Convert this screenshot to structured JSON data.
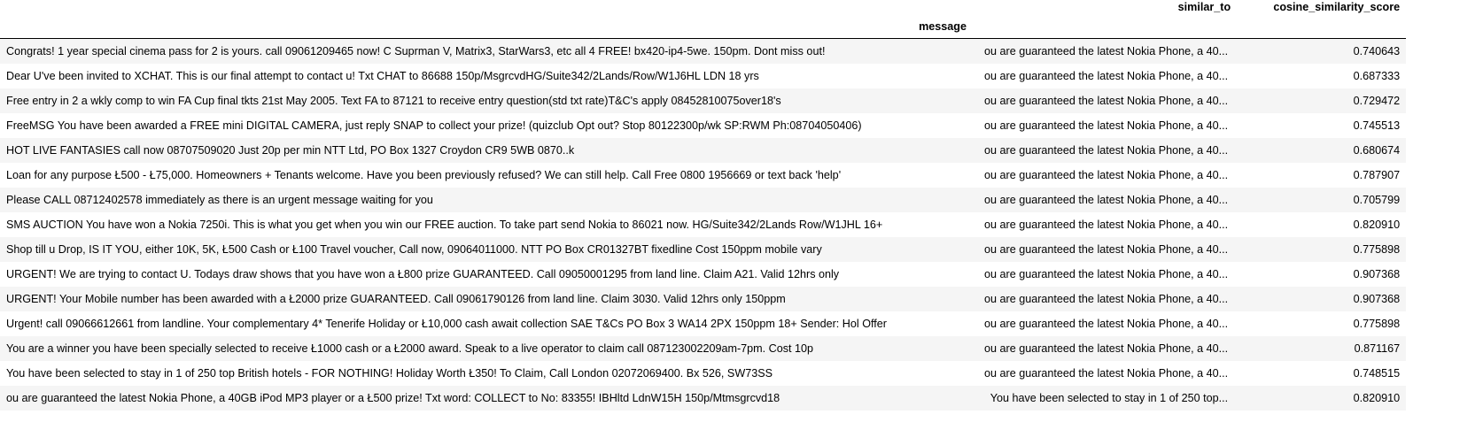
{
  "columns": {
    "message": "message",
    "similar_to": "similar_to",
    "score": "cosine_similarity_score"
  },
  "rows": [
    {
      "message": "Congrats! 1 year special cinema pass for 2 is yours. call 09061209465 now! C Suprman V, Matrix3, StarWars3, etc all 4 FREE! bx420-ip4-5we. 150pm. Dont miss out!",
      "similar_to": "ou are guaranteed the latest Nokia Phone, a 40...",
      "score": "0.740643"
    },
    {
      "message": "Dear U've been invited to XCHAT. This is our final attempt to contact u! Txt CHAT to 86688 150p/MsgrcvdHG/Suite342/2Lands/Row/W1J6HL LDN 18 yrs",
      "similar_to": "ou are guaranteed the latest Nokia Phone, a 40...",
      "score": "0.687333"
    },
    {
      "message": "Free entry in 2 a wkly comp to win FA Cup final tkts 21st May 2005. Text FA to 87121 to receive entry question(std txt rate)T&C's apply 08452810075over18's",
      "similar_to": "ou are guaranteed the latest Nokia Phone, a 40...",
      "score": "0.729472"
    },
    {
      "message": "FreeMSG You have been awarded a FREE mini DIGITAL CAMERA, just reply SNAP to collect your prize! (quizclub Opt out? Stop 80122300p/wk SP:RWM Ph:08704050406)",
      "similar_to": "ou are guaranteed the latest Nokia Phone, a 40...",
      "score": "0.745513"
    },
    {
      "message": "HOT LIVE FANTASIES call now 08707509020 Just 20p per min NTT Ltd, PO Box 1327 Croydon CR9 5WB 0870..k",
      "similar_to": "ou are guaranteed the latest Nokia Phone, a 40...",
      "score": "0.680674"
    },
    {
      "message": "Loan for any purpose Ł500 - Ł75,000. Homeowners + Tenants welcome. Have you been previously refused? We can still help. Call Free 0800 1956669 or text back 'help'",
      "similar_to": "ou are guaranteed the latest Nokia Phone, a 40...",
      "score": "0.787907"
    },
    {
      "message": "Please CALL 08712402578 immediately as there is an urgent message waiting for you",
      "similar_to": "ou are guaranteed the latest Nokia Phone, a 40...",
      "score": "0.705799"
    },
    {
      "message": "SMS AUCTION You have won a Nokia 7250i. This is what you get when you win our FREE auction. To take part send Nokia to 86021 now. HG/Suite342/2Lands Row/W1JHL 16+",
      "similar_to": "ou are guaranteed the latest Nokia Phone, a 40...",
      "score": "0.820910"
    },
    {
      "message": "Shop till u Drop, IS IT YOU, either 10K, 5K, Ł500 Cash or Ł100 Travel voucher, Call now, 09064011000. NTT PO Box CR01327BT fixedline Cost 150ppm mobile vary",
      "similar_to": "ou are guaranteed the latest Nokia Phone, a 40...",
      "score": "0.775898"
    },
    {
      "message": "URGENT! We are trying to contact U. Todays draw shows that you have won a Ł800 prize GUARANTEED. Call 09050001295 from land line. Claim A21. Valid 12hrs only",
      "similar_to": "ou are guaranteed the latest Nokia Phone, a 40...",
      "score": "0.907368"
    },
    {
      "message": "URGENT! Your Mobile number has been awarded with a Ł2000 prize GUARANTEED. Call 09061790126 from land line. Claim 3030. Valid 12hrs only 150ppm",
      "similar_to": "ou are guaranteed the latest Nokia Phone, a 40...",
      "score": "0.907368"
    },
    {
      "message": "Urgent! call 09066612661 from landline. Your complementary 4* Tenerife Holiday or Ł10,000 cash await collection SAE T&Cs PO Box 3 WA14 2PX 150ppm 18+ Sender: Hol Offer",
      "similar_to": "ou are guaranteed the latest Nokia Phone, a 40...",
      "score": "0.775898"
    },
    {
      "message": "You are a winner you have been specially selected to receive Ł1000 cash or a Ł2000 award. Speak to a live operator to claim call 087123002209am-7pm. Cost 10p",
      "similar_to": "ou are guaranteed the latest Nokia Phone, a 40...",
      "score": "0.871167"
    },
    {
      "message": "You have been selected to stay in 1 of 250 top British hotels - FOR NOTHING! Holiday Worth Ł350! To Claim, Call London 02072069400. Bx 526, SW73SS",
      "similar_to": "ou are guaranteed the latest Nokia Phone, a 40...",
      "score": "0.748515"
    },
    {
      "message": "ou are guaranteed the latest Nokia Phone, a 40GB iPod MP3 player or a Ł500 prize! Txt word: COLLECT to No: 83355! IBHltd LdnW15H 150p/Mtmsgrcvd18",
      "similar_to": "You have been selected to stay in 1 of 250 top...",
      "score": "0.820910"
    }
  ]
}
